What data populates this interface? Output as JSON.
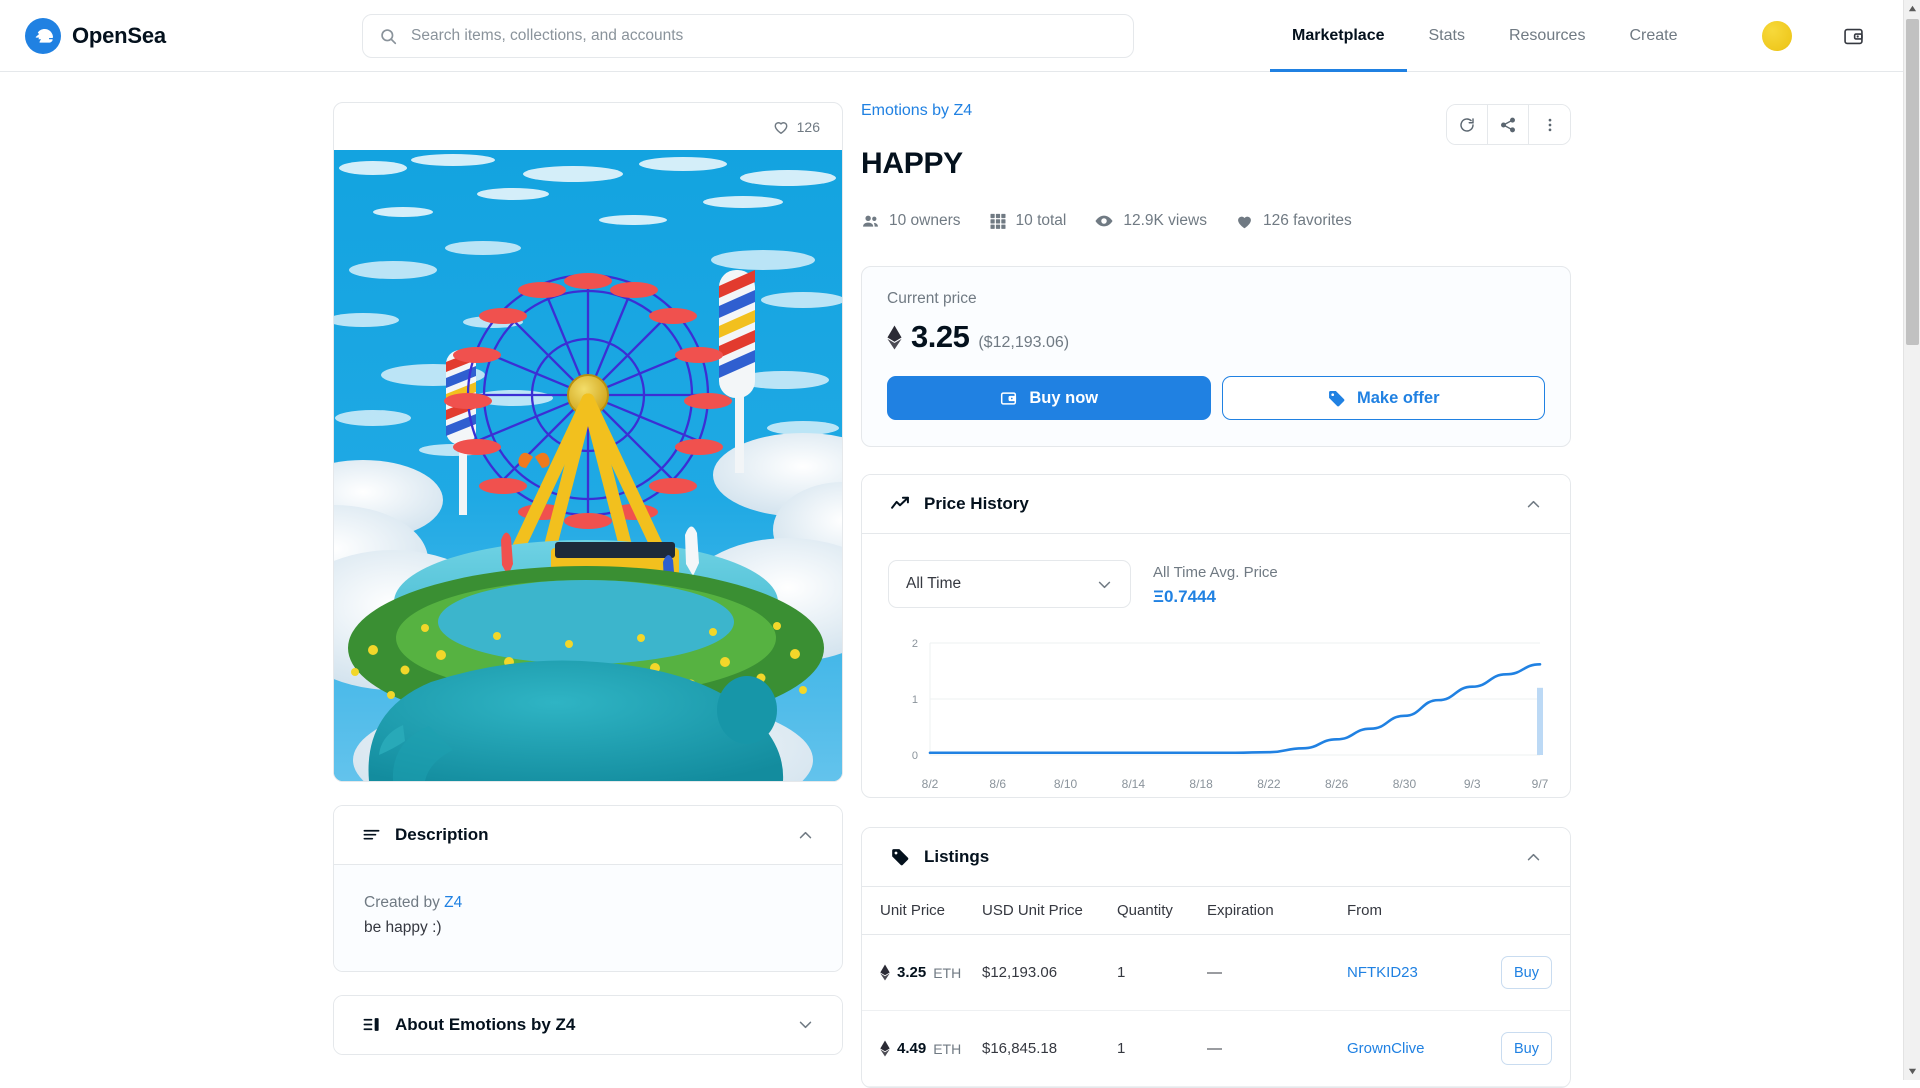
{
  "header": {
    "brand": "OpenSea",
    "search": {
      "placeholder": "Search items, collections, and accounts",
      "value": ""
    },
    "nav": [
      {
        "label": "Marketplace",
        "active": true
      },
      {
        "label": "Stats",
        "active": false
      },
      {
        "label": "Resources",
        "active": false
      },
      {
        "label": "Create",
        "active": false
      }
    ],
    "avatar_color": "#efc91f",
    "wallet_icon": "wallet-icon"
  },
  "media": {
    "favorite_icon": "heart-outline-icon",
    "favorite_count": "126",
    "artwork_alt": "Ferris wheel atop a flower-covered blue head floating in clouds"
  },
  "item": {
    "collection": "Emotions by Z4",
    "title": "HAPPY",
    "stats": [
      {
        "icon": "owners-icon",
        "label": "10 owners"
      },
      {
        "icon": "grid-icon",
        "label": "10 total"
      },
      {
        "icon": "eye-icon",
        "label": "12.9K views"
      },
      {
        "icon": "heart-filled-icon",
        "label": "126 favorites"
      }
    ],
    "actions": [
      {
        "icon": "refresh-icon",
        "name": "refresh-button"
      },
      {
        "icon": "share-icon",
        "name": "share-button"
      },
      {
        "icon": "more-vertical-icon",
        "name": "more-options-button"
      }
    ]
  },
  "price": {
    "label": "Current price",
    "eth_icon": "ethereum-icon",
    "eth_amount": "3.25",
    "usd_amount": "($12,193.06)",
    "buy_now": "Buy now",
    "buy_now_icon": "wallet-icon",
    "make_offer": "Make offer",
    "make_offer_icon": "tag-icon",
    "accent": "#2081e2"
  },
  "price_history": {
    "icon": "chart-line-icon",
    "title": "Price History",
    "collapse_icon": "chevron-up-icon",
    "range_select": {
      "value": "All Time",
      "chevron": "chevron-down-icon"
    },
    "avg_label": "All Time Avg. Price",
    "avg_value": "Ξ0.7444"
  },
  "chart_data": {
    "type": "line",
    "title": "Price History",
    "xlabel": "",
    "ylabel": "",
    "ylim": [
      0,
      2
    ],
    "yticks": [
      "0",
      "1",
      "2"
    ],
    "xticks": [
      "8/2",
      "8/6",
      "8/10",
      "8/14",
      "8/18",
      "8/22",
      "8/26",
      "8/30",
      "9/3",
      "9/7"
    ],
    "grid": true,
    "legend": false,
    "line_color": "#2081e2",
    "bar_color": "#bcd9f5",
    "series": [
      {
        "name": "Average Price (ETH)",
        "x": [
          "8/2",
          "8/4",
          "8/6",
          "8/8",
          "8/10",
          "8/12",
          "8/14",
          "8/16",
          "8/18",
          "8/20",
          "8/22",
          "8/24",
          "8/26",
          "8/28",
          "8/30",
          "9/1",
          "9/3",
          "9/5",
          "9/7"
        ],
        "values": [
          0.04,
          0.04,
          0.04,
          0.04,
          0.04,
          0.04,
          0.04,
          0.04,
          0.04,
          0.04,
          0.05,
          0.12,
          0.28,
          0.47,
          0.7,
          0.98,
          1.22,
          1.44,
          1.62
        ]
      }
    ],
    "volume_bars": [
      {
        "x": "9/7",
        "value": 1.2
      }
    ]
  },
  "listings": {
    "icon": "tag-icon",
    "title": "Listings",
    "collapse_icon": "chevron-up-icon",
    "columns": [
      "Unit Price",
      "USD Unit Price",
      "Quantity",
      "Expiration",
      "From",
      ""
    ],
    "rows": [
      {
        "eth_icon": "ethereum-icon",
        "unit_price": "3.25",
        "unit": "ETH",
        "usd_unit_price": "$12,193.06",
        "quantity": "1",
        "expiration": "—",
        "from": "NFTKID23",
        "buy_label": "Buy"
      },
      {
        "eth_icon": "ethereum-icon",
        "unit_price": "4.49",
        "unit": "ETH",
        "usd_unit_price": "$16,845.18",
        "quantity": "1",
        "expiration": "—",
        "from": "GrownClive",
        "buy_label": "Buy"
      }
    ]
  },
  "description": {
    "icon": "description-icon",
    "title": "Description",
    "collapse_icon": "chevron-up-icon",
    "created_by_prefix": "Created by ",
    "creator": "Z4",
    "body": "be happy :)"
  },
  "about": {
    "icon": "about-icon",
    "title": "About Emotions by Z4",
    "expand_icon": "chevron-down-icon"
  },
  "scrollbar": {
    "up_icon": "scroll-up-arrow-icon",
    "down_icon": "scroll-down-arrow-icon"
  }
}
